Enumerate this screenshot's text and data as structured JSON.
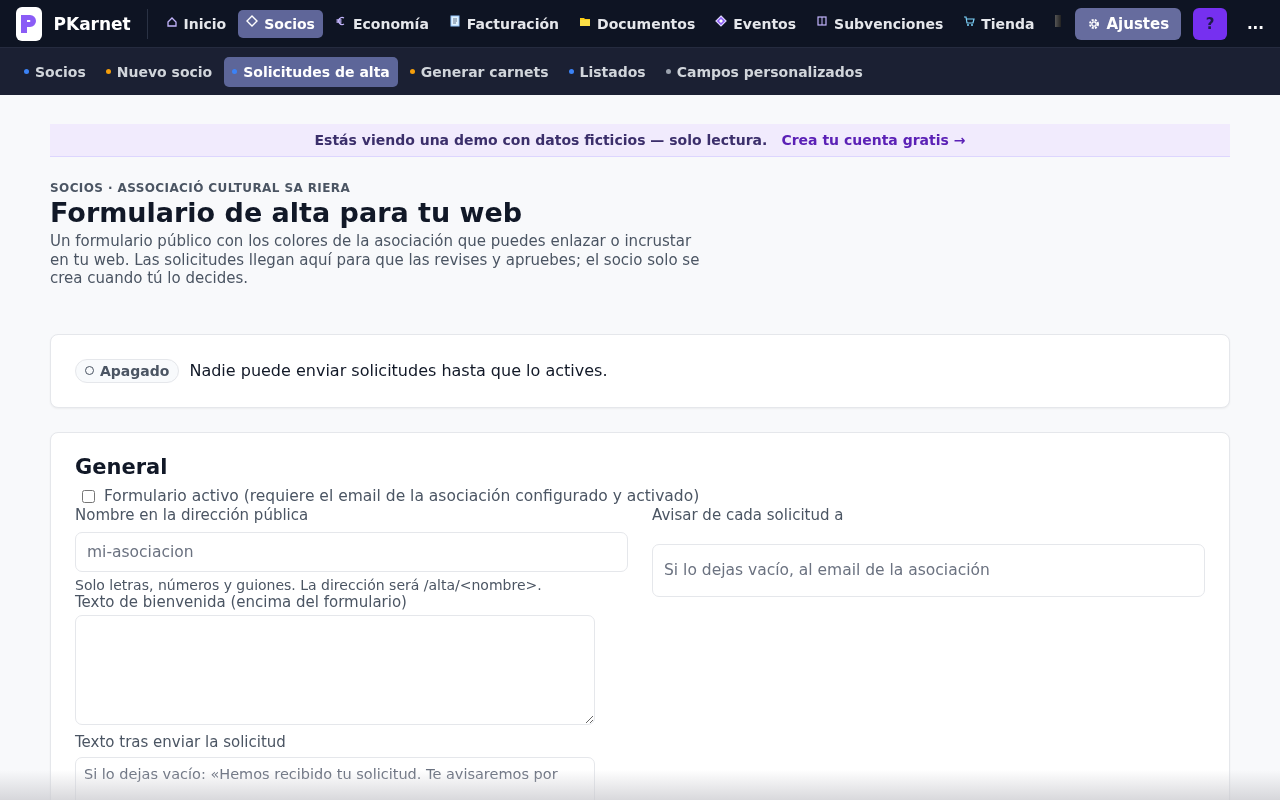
{
  "app": {
    "name": "PKarnet"
  },
  "nav": [
    {
      "label": "Inicio",
      "selected": false
    },
    {
      "label": "Socios",
      "selected": true
    },
    {
      "label": "Economía",
      "selected": false
    },
    {
      "label": "Facturación",
      "selected": false
    },
    {
      "label": "Documentos",
      "selected": false
    },
    {
      "label": "Eventos",
      "selected": false
    },
    {
      "label": "Subvenciones",
      "selected": false
    },
    {
      "label": "Tienda",
      "selected": false
    }
  ],
  "settings_button": "Ajustes",
  "help_button": "?",
  "more_button": "...",
  "subnav": [
    {
      "label": "Socios",
      "selected": false,
      "color": "#3b82f6"
    },
    {
      "label": "Nuevo socio",
      "selected": false,
      "color": "#f59e0b"
    },
    {
      "label": "Solicitudes de alta",
      "selected": true,
      "color": "#3b82f6"
    },
    {
      "label": "Generar carnets",
      "selected": false,
      "color": "#f59e0b"
    },
    {
      "label": "Listados",
      "selected": false,
      "color": "#3b82f6"
    },
    {
      "label": "Campos personalizados",
      "selected": false,
      "color": "#9ca3af"
    }
  ],
  "banner": {
    "text": "Estás viendo una demo con datos ficticios — solo lectura.",
    "link": "Crea tu cuenta gratis →"
  },
  "breadcrumb": "SOCIOS · ASSOCIACIÓ CULTURAL SA RIERA",
  "title": "Formulario de alta para tu web",
  "description": "Un formulario público con los colores de la asociación que puedes enlazar o incrustar en tu web. Las solicitudes llegan aquí para que las revises y apruebes; el socio solo se crea cuando tú lo decides.",
  "status": {
    "on": false,
    "badge": "Apagado",
    "message": "Nadie puede enviar solicitudes hasta que lo actives."
  },
  "general": {
    "heading": "General",
    "active_checkbox": {
      "label": "Formulario activo (requiere el email de la asociación configurado y activado)",
      "checked": false
    },
    "slug": {
      "label": "Nombre en la dirección pública",
      "placeholder": "mi-asociacion",
      "hint": "Solo letras, números y guiones. La dirección será /alta/<nombre>."
    },
    "notify": {
      "label": "Avisar de cada solicitud a",
      "placeholder": "Si lo dejas vacío, al email de la asociación"
    },
    "welcome": {
      "label": "Texto de bienvenida (encima del formulario)"
    },
    "thanks": {
      "label": "Texto tras enviar la solicitud",
      "placeholder": "Si lo dejas vacío: «Hemos recibido tu solicitud. Te avisaremos por"
    }
  }
}
